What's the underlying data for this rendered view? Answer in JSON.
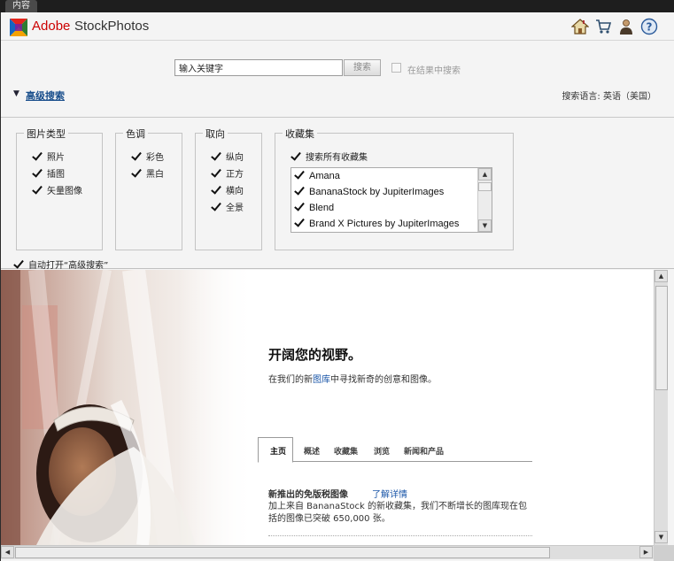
{
  "tab": {
    "label": "内容"
  },
  "header": {
    "brand_adobe": "Adobe",
    "brand_product": "StockPhotos",
    "icons": [
      "home-icon",
      "cart-icon",
      "user-icon",
      "help-icon"
    ]
  },
  "search": {
    "input_value": "输入关键字",
    "button_label": "搜索",
    "within_label": "在结果中搜索",
    "advanced_label": "高级搜索",
    "language_label": "搜索语言: 英语（美国）"
  },
  "filters": {
    "image_type": {
      "title": "图片类型",
      "options": [
        "照片",
        "插图",
        "矢量图像"
      ]
    },
    "color": {
      "title": "色调",
      "options": [
        "彩色",
        "黑白"
      ]
    },
    "orientation": {
      "title": "取向",
      "options": [
        "纵向",
        "正方",
        "横向",
        "全景"
      ]
    },
    "collections": {
      "title": "收藏集",
      "all_label": "搜索所有收藏集",
      "items": [
        "Amana",
        "BananaStock by JupiterImages",
        "Blend",
        "Brand X Pictures by JupiterImages"
      ]
    },
    "auto_open_label": "自动打开“高级搜索”"
  },
  "content": {
    "headline": "开阔您的视野。",
    "sub_before": "在我们的新",
    "sub_link": "图库",
    "sub_after": "中寻找新奇的创意和图像。",
    "tabs": [
      "主页",
      "概述",
      "收藏集",
      "浏览",
      "新闻和产品"
    ],
    "news_title": "新推出的免版税图像",
    "news_more": "了解详情",
    "news_body": "加上来自 BananaStock 的新收藏集，我们不断增长的图库现在包括的图像已突破 650,000 张。"
  },
  "colors": {
    "brand_red": "#cc0000",
    "link_blue": "#1a56a8"
  }
}
